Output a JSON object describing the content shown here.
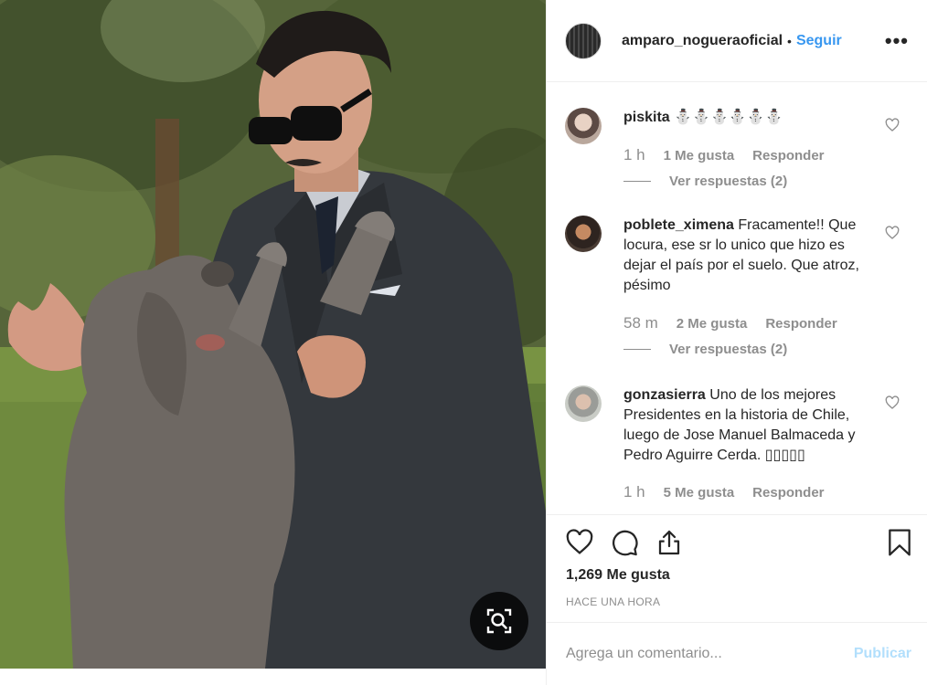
{
  "post": {
    "photo_alt": "",
    "zoom_icon": "zoom-search-icon"
  },
  "header": {
    "username": "amparo_nogueraoficial",
    "separator": "•",
    "follow_label": "Seguir",
    "more_icon": "more-options-icon",
    "more_label": "•••"
  },
  "comments": [
    {
      "user": "piskita",
      "text": "⛄⛄⛄⛄⛄⛄",
      "time": "1 h",
      "likes": "1 Me gusta",
      "reply": "Responder",
      "replies": "Ver respuestas (2)"
    },
    {
      "user": "poblete_ximena",
      "text": "Fracamente!! Que locura, ese sr lo unico que hizo es dejar el país por el suelo. Que atroz, pésimo",
      "time": "58 m",
      "likes": "2 Me gusta",
      "reply": "Responder",
      "replies": "Ver respuestas (2)"
    },
    {
      "user": "gonzasierra",
      "text": "Uno de los mejores Presidentes en la historia de Chile, luego de Jose Manuel Balmaceda y Pedro Aguirre Cerda. ▯▯▯▯▯",
      "time": "1 h",
      "likes": "5 Me gusta",
      "reply": "Responder",
      "replies": ""
    }
  ],
  "actions": {
    "like_icon": "heart-icon",
    "comment_icon": "comment-icon",
    "share_icon": "share-icon",
    "save_icon": "bookmark-icon"
  },
  "likes_count": "1,269 Me gusta",
  "timestamp": "HACE UNA HORA",
  "add_comment": {
    "placeholder": "Agrega un comentario...",
    "publish_label": "Publicar"
  },
  "colors": {
    "link_blue": "#3897f0",
    "publish_disabled": "#b2dffc",
    "muted": "#8e8e8e",
    "text": "#262626"
  }
}
